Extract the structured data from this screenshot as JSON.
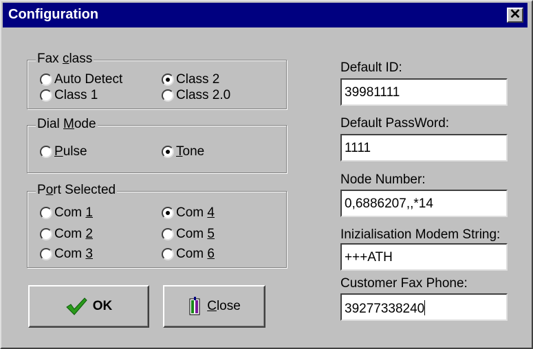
{
  "window": {
    "title": "Configuration",
    "close_glyph": "✕"
  },
  "fax_class": {
    "legend_html": "Fax <u>c</u>lass",
    "options": [
      {
        "label": "Auto Detect",
        "selected": false
      },
      {
        "label": "Class 2",
        "selected": true
      },
      {
        "label": "Class 1",
        "selected": false
      },
      {
        "label": "Class 2.0",
        "selected": false
      }
    ]
  },
  "dial_mode": {
    "legend_html": "Dial <u>M</u>ode",
    "options": [
      {
        "label_html": "<u>P</u>ulse",
        "selected": false
      },
      {
        "label_html": "<u>T</u>one",
        "selected": true
      }
    ]
  },
  "port_selected": {
    "legend_html": "P<u>o</u>rt Selected",
    "options": [
      {
        "label_html": "Com <u>1</u>",
        "selected": false
      },
      {
        "label_html": "Com <u>4</u>",
        "selected": true
      },
      {
        "label_html": "Com <u>2</u>",
        "selected": false
      },
      {
        "label_html": "Com <u>5</u>",
        "selected": false
      },
      {
        "label_html": "Com <u>3</u>",
        "selected": false
      },
      {
        "label_html": "Com <u>6</u>",
        "selected": false
      }
    ]
  },
  "fields": {
    "default_id": {
      "label": "Default ID:",
      "value": "39981111"
    },
    "default_password": {
      "label": "Default PassWord:",
      "value": "1111"
    },
    "node_number": {
      "label": "Node Number:",
      "value": "0,6886207,,*14"
    },
    "init_string": {
      "label": "Inizialisation Modem String:",
      "value": "+++ATH"
    },
    "customer_fax": {
      "label": "Customer Fax Phone:",
      "value": "39277338240"
    }
  },
  "buttons": {
    "ok_label": "OK",
    "close_html": "<u>C</u>lose"
  },
  "colors": {
    "title_bar": "#000080",
    "face": "#c0c0c0",
    "ok_check": "#2a9a1a"
  }
}
